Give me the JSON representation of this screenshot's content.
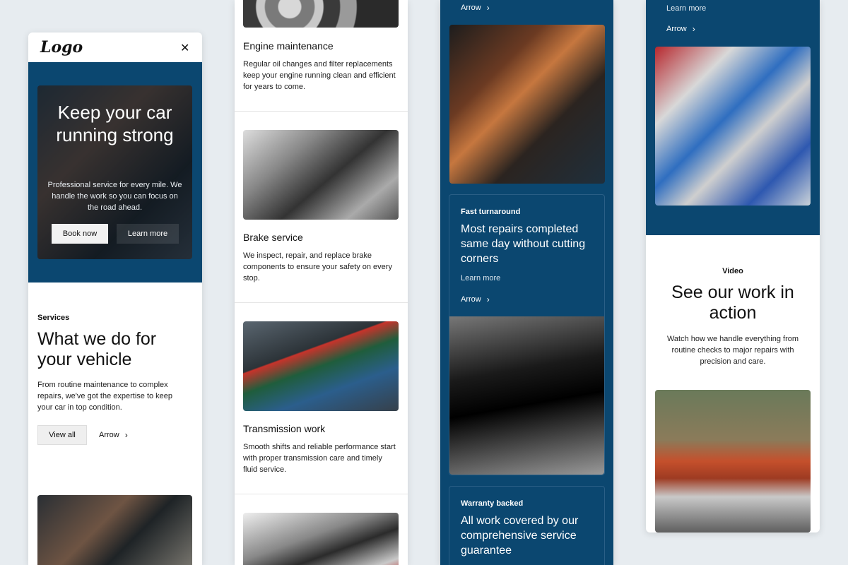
{
  "col1": {
    "logo": "Logo",
    "close_icon": "close-icon",
    "hero": {
      "title": "Keep your car running strong",
      "subtitle": "Professional service for every mile. We handle the work so you can focus on the road ahead.",
      "book_label": "Book now",
      "learn_label": "Learn more"
    },
    "services": {
      "eyebrow": "Services",
      "title": "What we do for your vehicle",
      "body": "From routine maintenance to complex repairs, we've got the expertise to keep your car in top condition.",
      "view_all_label": "View all",
      "arrow_label": "Arrow"
    }
  },
  "col2": {
    "cards": [
      {
        "title": "Engine maintenance",
        "body": "Regular oil changes and filter replacements keep your engine running clean and efficient for years to come."
      },
      {
        "title": "Brake service",
        "body": "We inspect, repair, and replace brake components to ensure your safety on every stop."
      },
      {
        "title": "Transmission work",
        "body": "Smooth shifts and reliable performance start with proper transmission care and timely fluid service."
      }
    ]
  },
  "col3": {
    "top_arrow_label": "Arrow",
    "cards": [
      {
        "eyebrow": "Fast turnaround",
        "title": "Most repairs completed same day without cutting corners",
        "learn_label": "Learn more",
        "arrow_label": "Arrow"
      },
      {
        "eyebrow": "Warranty backed",
        "title": "All work covered by our comprehensive service guarantee"
      }
    ]
  },
  "col4": {
    "learn_label": "Learn more",
    "arrow_label": "Arrow",
    "video": {
      "eyebrow": "Video",
      "title": "See our work in action",
      "body": "Watch how we handle everything from routine checks to major repairs with precision and care."
    }
  },
  "colors": {
    "brand_blue": "#0b4770",
    "background": "#e7ecf0"
  }
}
